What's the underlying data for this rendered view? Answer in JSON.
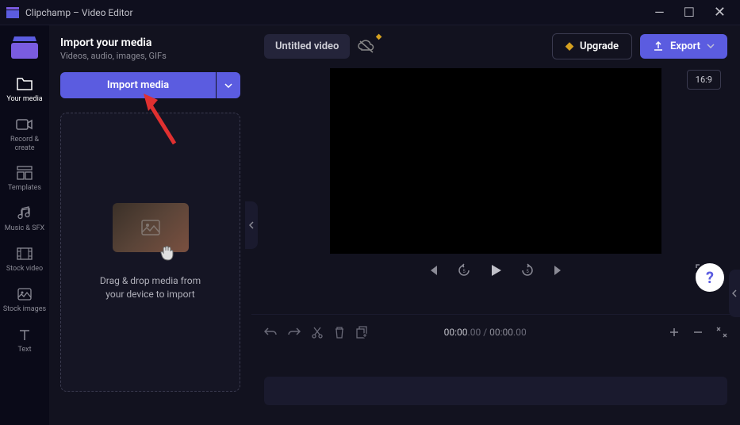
{
  "titlebar": {
    "title": "Clipchamp – Video Editor"
  },
  "sidebar": {
    "items": [
      {
        "label": "Your media"
      },
      {
        "label": "Record & create"
      },
      {
        "label": "Templates"
      },
      {
        "label": "Music & SFX"
      },
      {
        "label": "Stock video"
      },
      {
        "label": "Stock images"
      },
      {
        "label": "Text"
      }
    ]
  },
  "media_panel": {
    "title": "Import your media",
    "subtitle": "Videos, audio, images, GIFs",
    "import_label": "Import media",
    "drop_text_1": "Drag & drop media from",
    "drop_text_2": "your device to import"
  },
  "topbar": {
    "project_title": "Untitled video",
    "upgrade_label": "Upgrade",
    "export_label": "Export"
  },
  "preview": {
    "aspect_ratio": "16:9"
  },
  "timeline": {
    "current_time": "00:00",
    "current_frac": ".00",
    "total_time": "00:00",
    "total_frac": ".00"
  }
}
